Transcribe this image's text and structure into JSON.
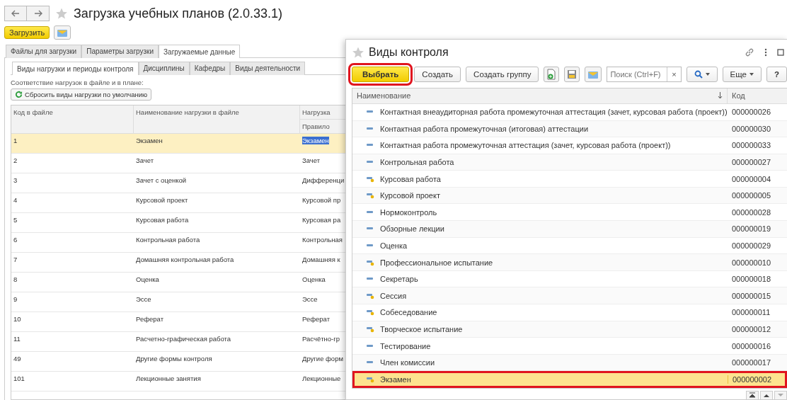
{
  "main_window": {
    "title": "Загрузка учебных планов (2.0.33.1)",
    "load_button": "Загрузить",
    "tabs": [
      {
        "label": "Файлы для загрузки",
        "selected": false
      },
      {
        "label": "Параметры загрузки",
        "selected": false
      },
      {
        "label": "Загружаемые данные",
        "selected": true
      }
    ],
    "subtabs": [
      {
        "label": "Виды нагрузки и периоды контроля",
        "selected": true
      },
      {
        "label": "Дисциплины",
        "selected": false
      },
      {
        "label": "Кафедры",
        "selected": false
      },
      {
        "label": "Виды деятельности",
        "selected": false
      }
    ],
    "section_label": "Соответствие нагрузок в файле и в плане:",
    "reset_button": "Сбросить виды нагрузки по умолчанию",
    "table": {
      "columns": [
        "Код в файле",
        "Наименование нагрузки в файле",
        "Нагрузка"
      ],
      "subheader": "Правило",
      "rows": [
        {
          "code": "1",
          "name": "Экзамен",
          "load": "Экзамен",
          "selected": true
        },
        {
          "code": "2",
          "name": "Зачет",
          "load": "Зачет",
          "selected": false
        },
        {
          "code": "3",
          "name": "Зачет с оценкой",
          "load": "Дифференци",
          "selected": false
        },
        {
          "code": "4",
          "name": "Курсовой проект",
          "load": "Курсовой пр",
          "selected": false
        },
        {
          "code": "5",
          "name": "Курсовая работа",
          "load": "Курсовая ра",
          "selected": false
        },
        {
          "code": "6",
          "name": "Контрольная работа",
          "load": "Контрольная",
          "selected": false
        },
        {
          "code": "7",
          "name": "Домашняя контрольная работа",
          "load": "Домашняя к",
          "selected": false
        },
        {
          "code": "8",
          "name": "Оценка",
          "load": "Оценка",
          "selected": false
        },
        {
          "code": "9",
          "name": "Эссе",
          "load": "Эссе",
          "selected": false
        },
        {
          "code": "10",
          "name": "Реферат",
          "load": "Реферат",
          "selected": false
        },
        {
          "code": "11",
          "name": "Расчетно-графическая работа",
          "load": "Расчётно-гр",
          "selected": false
        },
        {
          "code": "49",
          "name": "Другие формы контроля",
          "load": "Другие форм",
          "selected": false
        },
        {
          "code": "101",
          "name": "Лекционные занятия",
          "load": "Лекционные",
          "selected": false
        }
      ]
    }
  },
  "dialog": {
    "title": "Виды контроля",
    "buttons": [
      {
        "label": "Выбрать",
        "kind": "default",
        "highlighted": true
      },
      {
        "label": "Создать",
        "kind": "normal",
        "highlighted": false
      },
      {
        "label": "Создать группу",
        "kind": "normal",
        "highlighted": false
      }
    ],
    "search": {
      "placeholder": "Поиск (Ctrl+F)",
      "clear": "×"
    },
    "more_button": "Еще",
    "help_button": "?",
    "table": {
      "columns": [
        "Наименование",
        "Код"
      ],
      "rows": [
        {
          "name": "Контактная внеаудиторная работа промежуточная аттестация (зачет, курсовая работа (проект))",
          "code": "000000026",
          "kind": "plain",
          "selected": false,
          "highlighted": false
        },
        {
          "name": "Контактная работа промежуточная (итоговая) аттестации",
          "code": "000000030",
          "kind": "plain",
          "selected": false,
          "highlighted": false
        },
        {
          "name": "Контактная работа промежуточная аттестация (зачет, курсовая работа (проект))",
          "code": "000000033",
          "kind": "plain",
          "selected": false,
          "highlighted": false
        },
        {
          "name": "Контрольная работа",
          "code": "000000027",
          "kind": "plain",
          "selected": false,
          "highlighted": false
        },
        {
          "name": "Курсовая работа",
          "code": "000000004",
          "kind": "predefined",
          "selected": false,
          "highlighted": false
        },
        {
          "name": "Курсовой проект",
          "code": "000000005",
          "kind": "predefined",
          "selected": false,
          "highlighted": false
        },
        {
          "name": "Нормоконтроль",
          "code": "000000028",
          "kind": "plain",
          "selected": false,
          "highlighted": false
        },
        {
          "name": "Обзорные лекции",
          "code": "000000019",
          "kind": "plain",
          "selected": false,
          "highlighted": false
        },
        {
          "name": "Оценка",
          "code": "000000029",
          "kind": "plain",
          "selected": false,
          "highlighted": false
        },
        {
          "name": "Профессиональное испытание",
          "code": "000000010",
          "kind": "predefined",
          "selected": false,
          "highlighted": false
        },
        {
          "name": "Секретарь",
          "code": "000000018",
          "kind": "plain",
          "selected": false,
          "highlighted": false
        },
        {
          "name": "Сессия",
          "code": "000000015",
          "kind": "predefined",
          "selected": false,
          "highlighted": false
        },
        {
          "name": "Собеседование",
          "code": "000000011",
          "kind": "predefined",
          "selected": false,
          "highlighted": false
        },
        {
          "name": "Творческое испытание",
          "code": "000000012",
          "kind": "predefined",
          "selected": false,
          "highlighted": false
        },
        {
          "name": "Тестирование",
          "code": "000000016",
          "kind": "plain",
          "selected": false,
          "highlighted": false
        },
        {
          "name": "Член комиссии",
          "code": "000000017",
          "kind": "plain",
          "selected": false,
          "highlighted": false
        },
        {
          "name": "Экзамен",
          "code": "000000002",
          "kind": "predefined",
          "selected": true,
          "highlighted": true
        }
      ]
    }
  }
}
